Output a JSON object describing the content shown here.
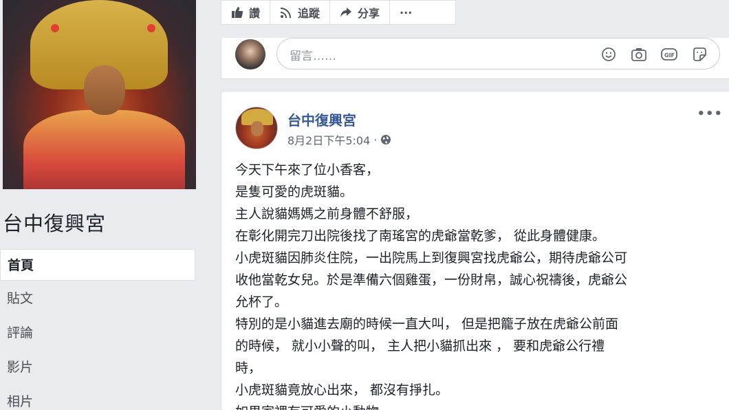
{
  "sidebar": {
    "page_name": "台中復興宮",
    "nav": [
      {
        "label": "首頁",
        "active": true
      },
      {
        "label": "貼文"
      },
      {
        "label": "評論"
      },
      {
        "label": "影片"
      },
      {
        "label": "相片"
      }
    ]
  },
  "action_bar": {
    "like": "讚",
    "follow": "追蹤",
    "share": "分享",
    "more": "···"
  },
  "comment_box": {
    "placeholder": "留言……",
    "icons": [
      "emoji-icon",
      "camera-icon",
      "gif-icon",
      "sticker-icon"
    ]
  },
  "post": {
    "author": "台中復興宮",
    "timestamp": "8月2日下午5:04",
    "separator": "·",
    "more": "•••",
    "lines": [
      "今天下午來了位小香客，",
      "是隻可愛的虎斑貓。",
      "主人說貓媽媽之前身體不舒服，",
      "在彰化開完刀出院後找了南瑤宮的虎爺當乾爹， 從此身體健康。",
      "小虎斑貓因肺炎住院，一出院馬上到復興宮找虎爺公，期待虎爺公可",
      "收他當乾女兒。於是準備六個雞蛋，一份財帛，誠心祝禱後，虎爺公",
      "允杯了。",
      "特別的是小貓進去廟的時候一直大叫， 但是把籠子放在虎爺公前面",
      "的時候， 就小小聲的叫， 主人把小貓抓出來 ， 要和虎爺公行禮",
      "時，",
      "小虎斑貓竟放心出來， 都沒有掙扎。",
      "如果家裡有可愛的小動物，"
    ]
  },
  "colors": {
    "link_blue": "#365899",
    "bg": "#e9ebee",
    "border": "#dddfe2"
  }
}
